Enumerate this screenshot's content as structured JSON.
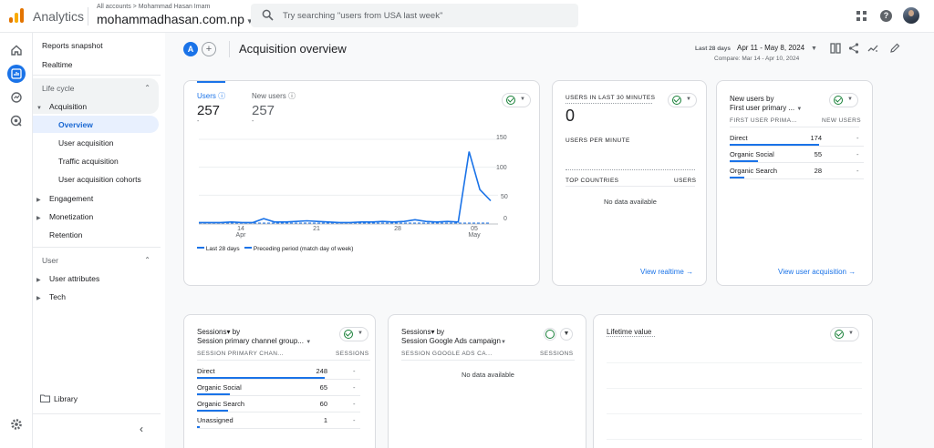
{
  "topbar": {
    "app_name": "Analytics",
    "account_crumb": "All accounts  >  Mohammad Hasan Imam",
    "account_name": "mohammadhasan.com.np",
    "search_placeholder": "Try searching \"users from USA last week\""
  },
  "nav": {
    "reports_snapshot": "Reports snapshot",
    "realtime": "Realtime",
    "lifecycle": "Life cycle",
    "acquisition": "Acquisition",
    "overview": "Overview",
    "user_acquisition": "User acquisition",
    "traffic_acquisition": "Traffic acquisition",
    "user_acquisition_cohorts": "User acquisition cohorts",
    "engagement": "Engagement",
    "monetization": "Monetization",
    "retention": "Retention",
    "user": "User",
    "user_attributes": "User attributes",
    "tech": "Tech",
    "library": "Library"
  },
  "header": {
    "badge": "A",
    "title": "Acquisition overview",
    "range_label": "Last 28 days",
    "range": "Apr 11 - May 8, 2024",
    "compare": "Compare: Mar 14 - Apr 10, 2024"
  },
  "users_card": {
    "users_label": "Users",
    "users_value": "257",
    "new_users_label": "New users",
    "new_users_value": "257",
    "dash": "-",
    "y_ticks": [
      "150",
      "100",
      "50",
      "0"
    ],
    "x_ticks": [
      {
        "day": "14",
        "month": "Apr"
      },
      {
        "day": "21",
        "month": ""
      },
      {
        "day": "28",
        "month": ""
      },
      {
        "day": "05",
        "month": "May"
      }
    ],
    "legend_current": "Last 28 days",
    "legend_previous": "Preceding period (match day of week)"
  },
  "chart_data": {
    "type": "line",
    "title": "",
    "xlabel": "",
    "ylabel": "",
    "ylim": [
      0,
      150
    ],
    "x": [
      "Apr 11",
      "Apr 12",
      "Apr 13",
      "Apr 14",
      "Apr 15",
      "Apr 16",
      "Apr 17",
      "Apr 18",
      "Apr 19",
      "Apr 20",
      "Apr 21",
      "Apr 22",
      "Apr 23",
      "Apr 24",
      "Apr 25",
      "Apr 26",
      "Apr 27",
      "Apr 28",
      "Apr 29",
      "Apr 30",
      "May 01",
      "May 02",
      "May 03",
      "May 04",
      "May 05",
      "May 06",
      "May 07",
      "May 08"
    ],
    "series": [
      {
        "name": "Last 28 days",
        "values": [
          1,
          1,
          1,
          2,
          1,
          1,
          8,
          2,
          2,
          3,
          4,
          3,
          2,
          1,
          1,
          2,
          2,
          3,
          2,
          3,
          6,
          3,
          2,
          3,
          2,
          128,
          60,
          40
        ]
      },
      {
        "name": "Preceding period (match day of week)",
        "values": [
          0,
          0,
          0,
          0,
          0,
          0,
          0,
          0,
          0,
          0,
          0,
          0,
          0,
          0,
          0,
          0,
          0,
          0,
          0,
          0,
          0,
          0,
          0,
          0,
          0,
          0,
          0,
          0
        ]
      }
    ]
  },
  "realtime_card": {
    "title": "USERS IN LAST 30 MINUTES",
    "value": "0",
    "per_minute": "USERS PER MINUTE",
    "col_countries": "TOP COUNTRIES",
    "col_users": "USERS",
    "empty": "No data available",
    "link": "View realtime"
  },
  "newusers_card": {
    "title": "New users by",
    "subtitle": "First user primary ...",
    "col_dim": "FIRST USER PRIMA...",
    "col_metric": "NEW USERS",
    "rows": [
      {
        "label": "Direct",
        "value": "174",
        "pct": 1.0
      },
      {
        "label": "Organic Social",
        "value": "55",
        "pct": 0.32
      },
      {
        "label": "Organic Search",
        "value": "28",
        "pct": 0.16
      }
    ],
    "dash": "-",
    "link": "View user acquisition"
  },
  "sessions_card": {
    "title": "Sessions▾ by",
    "subtitle": "Session primary channel group...",
    "col_dim": "SESSION PRIMARY CHAN...",
    "col_metric": "SESSIONS",
    "rows": [
      {
        "label": "Direct",
        "value": "248",
        "pct": 1.0
      },
      {
        "label": "Organic Social",
        "value": "65",
        "pct": 0.26
      },
      {
        "label": "Organic Search",
        "value": "60",
        "pct": 0.24
      },
      {
        "label": "Unassigned",
        "value": "1",
        "pct": 0.02
      }
    ],
    "dash": "-"
  },
  "ads_card": {
    "title": "Sessions▾ by",
    "subtitle": "Session Google Ads campaign",
    "col_dim": "SESSION GOOGLE ADS CA...",
    "col_metric": "SESSIONS",
    "empty": "No data available"
  },
  "ltv_card": {
    "title": "Lifetime value"
  }
}
